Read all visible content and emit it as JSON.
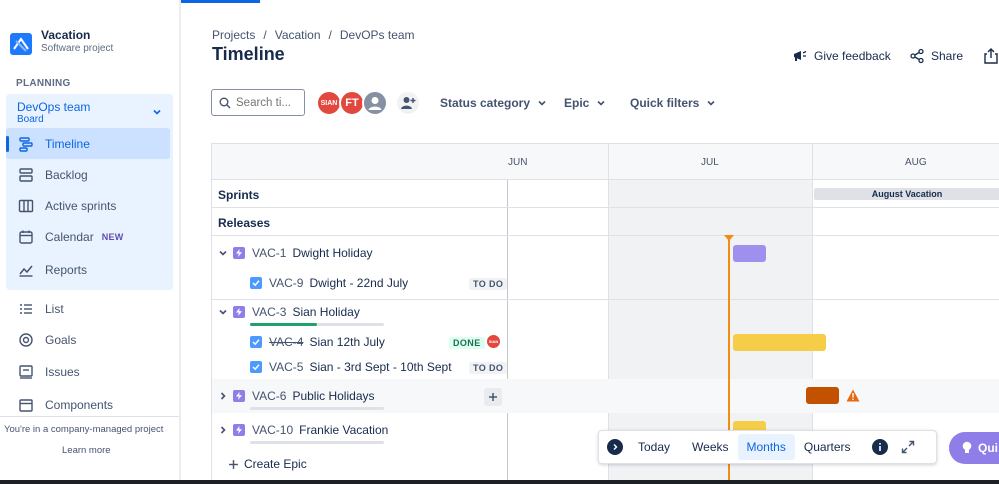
{
  "project": {
    "name": "Vacation",
    "type": "Software project"
  },
  "sidebar": {
    "section_label": "PLANNING",
    "board": {
      "name": "DevOps team",
      "sub": "Board"
    },
    "items": [
      {
        "label": "Timeline",
        "icon": "timeline-icon"
      },
      {
        "label": "Backlog",
        "icon": "backlog-icon"
      },
      {
        "label": "Active sprints",
        "icon": "active-sprints-icon"
      },
      {
        "label": "Calendar",
        "icon": "calendar-icon",
        "badge": "NEW"
      },
      {
        "label": "Reports",
        "icon": "reports-icon"
      }
    ],
    "extra_items": [
      {
        "label": "List",
        "icon": "list-icon"
      },
      {
        "label": "Goals",
        "icon": "goals-icon"
      },
      {
        "label": "Issues",
        "icon": "issues-icon"
      },
      {
        "label": "Components",
        "icon": "components-icon"
      }
    ],
    "footer_note": "You're in a company-managed project",
    "learn_more": "Learn more"
  },
  "breadcrumbs": [
    "Projects",
    "/",
    "Vacation",
    "/",
    "DevOPs team"
  ],
  "page_title": "Timeline",
  "header_actions": {
    "feedback": "Give feedback",
    "share": "Share"
  },
  "filters": {
    "search_placeholder": "Search ti...",
    "avatars": [
      {
        "initials": "SIAN",
        "color": "#e2483d"
      },
      {
        "initials": "FT",
        "color": "#e2483d"
      }
    ],
    "status_category": "Status category",
    "epic": "Epic",
    "quick_filters": "Quick filters"
  },
  "timeline": {
    "months": [
      "JUN",
      "JUL",
      "AUG"
    ],
    "sprints_label": "Sprints",
    "releases_label": "Releases",
    "sprint_bar": "August Vacation",
    "epics": [
      {
        "key": "VAC-1",
        "title": "Dwight Holiday",
        "children": [
          {
            "key": "VAC-9",
            "title": "Dwight - 22nd July",
            "status": "TO DO"
          }
        ]
      },
      {
        "key": "VAC-3",
        "title": "Sian Holiday",
        "progress": 0.5,
        "children": [
          {
            "key": "VAC-4",
            "title": "Sian 12th July",
            "status": "DONE",
            "assignee": "SIAN"
          },
          {
            "key": "VAC-5",
            "title": "Sian - 3rd Sept - 10th Sept",
            "status": "TO DO"
          }
        ]
      },
      {
        "key": "VAC-6",
        "title": "Public Holidays",
        "progress": 0
      },
      {
        "key": "VAC-10",
        "title": "Frankie Vacation",
        "progress": 0
      }
    ],
    "create_epic": "Create Epic",
    "colors": {
      "vac1_bar": "#9f8fef",
      "vac4_bar": "#f5cd47",
      "vac6_bar": "#c25100",
      "today": "#f18d13"
    }
  },
  "zoom": {
    "today": "Today",
    "weeks": "Weeks",
    "months": "Months",
    "quarters": "Quarters",
    "selected": "Months"
  },
  "quickstart": "Qui"
}
